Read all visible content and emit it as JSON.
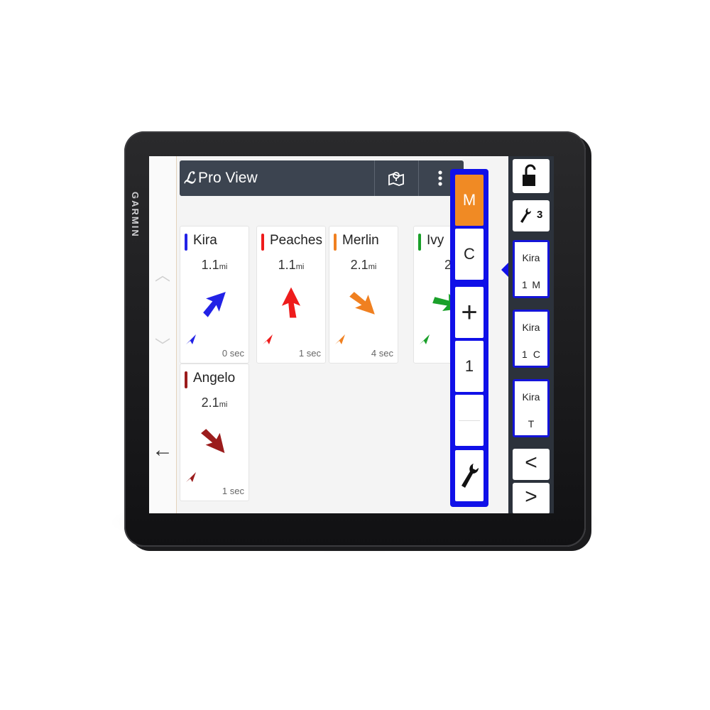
{
  "device": {
    "brand": "GARMIN"
  },
  "header": {
    "title": "Pro View",
    "map_icon": "map-pin-icon",
    "menu_icon": "more-vert-icon"
  },
  "cards": [
    {
      "name": "Kira",
      "dist": "1.1",
      "unit": "mi",
      "age": "0 sec",
      "color": "#2222e6",
      "heading": 45
    },
    {
      "name": "Peaches",
      "dist": "1.1",
      "unit": "mi",
      "age": "1 sec",
      "color": "#ee1c1c",
      "heading": 0
    },
    {
      "name": "Merlin",
      "dist": "2.1",
      "unit": "mi",
      "age": "4 sec",
      "color": "#f08020",
      "heading": 135
    },
    {
      "name": "Ivy",
      "dist": "2",
      "unit": "",
      "age": "",
      "color": "#1aa02a",
      "heading": 110
    },
    {
      "name": "Angelo",
      "dist": "2.1",
      "unit": "mi",
      "age": "1 sec",
      "color": "#9b1c1c",
      "heading": 140
    }
  ],
  "popup": {
    "m_label": "M",
    "c_label": "C",
    "plus_label": "+",
    "count": "1",
    "wrench_icon": "wrench-icon",
    "accent": "#f08a24"
  },
  "right_panel": {
    "lock_icon": "lock-open-icon",
    "tools_count": "3",
    "buttons": [
      {
        "name": "Kira",
        "left": "1",
        "right": "M"
      },
      {
        "name": "Kira",
        "left": "1",
        "right": "C"
      },
      {
        "name": "Kira",
        "left": "T",
        "right": ""
      }
    ],
    "prev_label": "<",
    "next_label": ">"
  },
  "nav": {
    "back_label": "←"
  }
}
